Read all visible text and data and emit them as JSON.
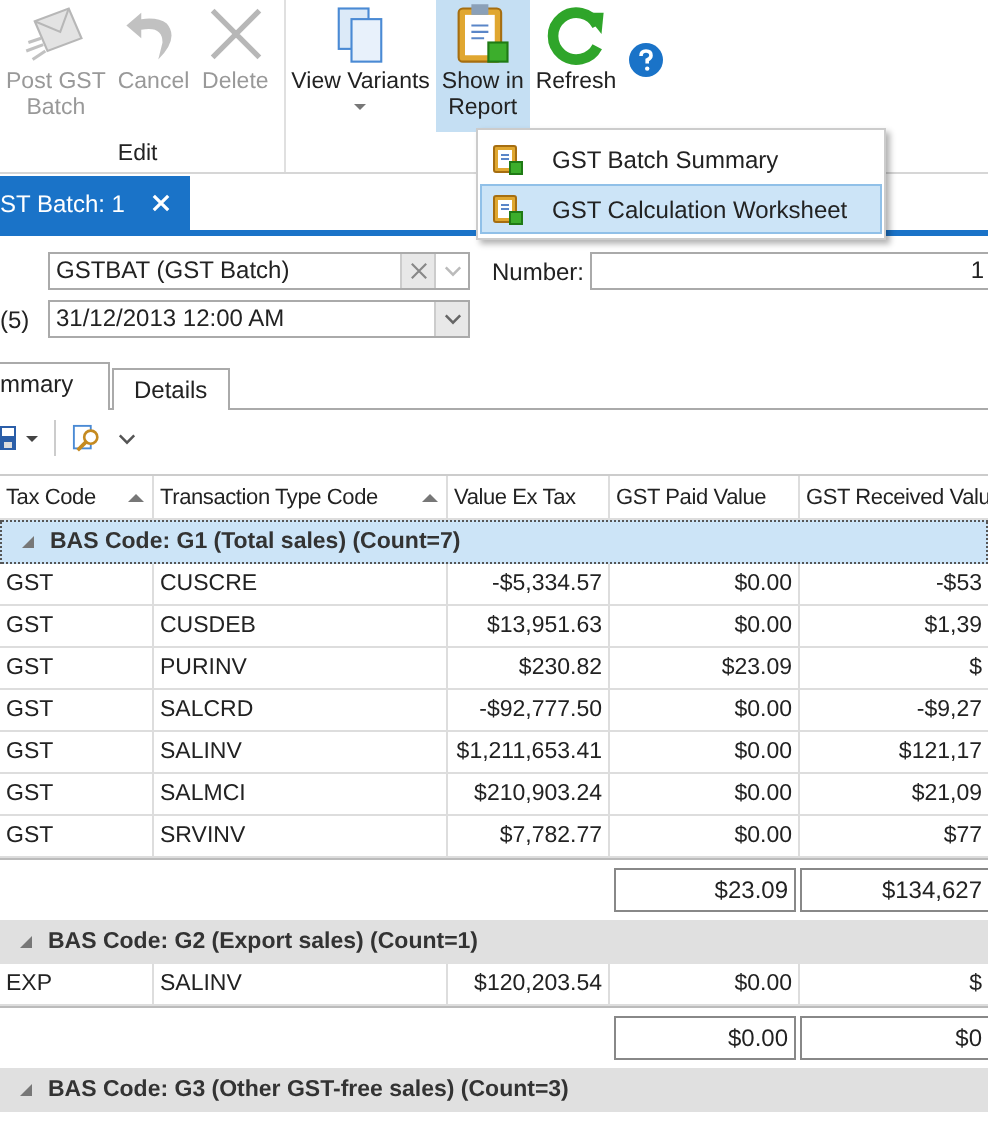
{
  "ribbon": {
    "groups": [
      {
        "label": "Edit",
        "buttons": [
          {
            "label": "Post GST\nBatch",
            "kind": "mail",
            "disabled": true,
            "dropdown": false,
            "selected": false
          },
          {
            "label": "Cancel",
            "kind": "undo",
            "disabled": true,
            "dropdown": false,
            "selected": false
          },
          {
            "label": "Delete",
            "kind": "delete",
            "disabled": true,
            "dropdown": false,
            "selected": false
          }
        ]
      },
      {
        "buttons": [
          {
            "label": "View Variants",
            "kind": "pages",
            "disabled": false,
            "dropdown": true,
            "selected": false
          },
          {
            "label": "Show in\nReport",
            "kind": "report",
            "disabled": false,
            "dropdown": true,
            "selected": true
          },
          {
            "label": "Refresh",
            "kind": "refresh",
            "disabled": false,
            "dropdown": false,
            "selected": false
          },
          {
            "kind": "help",
            "disabled": false,
            "dropdown": false,
            "selected": false
          }
        ]
      }
    ]
  },
  "menu": {
    "items": [
      {
        "label": "GST Batch Summary",
        "selected": false
      },
      {
        "label": "GST Calculation Worksheet",
        "selected": true
      }
    ]
  },
  "document_tabs": [
    {
      "label": "ST Batch: 1",
      "selected": true
    }
  ],
  "form": {
    "document_type": "GSTBAT (GST Batch)",
    "number_label": "Number:",
    "number": "1",
    "date_label": "(5)",
    "date": "31/12/2013 12:00 AM"
  },
  "subtabs": [
    {
      "label": "mmary",
      "selected": true
    },
    {
      "label": "Details",
      "selected": false
    }
  ],
  "grid": {
    "columns": [
      {
        "label": "Tax Code",
        "sorted": true
      },
      {
        "label": "Transaction Type Code",
        "sorted": true
      },
      {
        "label": "Value Ex Tax",
        "sorted": false
      },
      {
        "label": "GST Paid Value",
        "sorted": false
      },
      {
        "label": "GST Received Valu",
        "sorted": false
      }
    ],
    "groups": [
      {
        "title": "BAS Code: G1 (Total sales) (Count=7)",
        "selected": true,
        "rows": [
          [
            "GST",
            "CUSCRE",
            "-$5,334.57",
            "$0.00",
            "-$53"
          ],
          [
            "GST",
            "CUSDEB",
            "$13,951.63",
            "$0.00",
            "$1,39"
          ],
          [
            "GST",
            "PURINV",
            "$230.82",
            "$23.09",
            "$"
          ],
          [
            "GST",
            "SALCRD",
            "-$92,777.50",
            "$0.00",
            "-$9,27"
          ],
          [
            "GST",
            "SALINV",
            "$1,211,653.41",
            "$0.00",
            "$121,17"
          ],
          [
            "GST",
            "SALMCI",
            "$210,903.24",
            "$0.00",
            "$21,09"
          ],
          [
            "GST",
            "SRVINV",
            "$7,782.77",
            "$0.00",
            "$77"
          ]
        ],
        "totals": [
          "$23.09",
          "$134,627"
        ]
      },
      {
        "title": "BAS Code: G2 (Export sales) (Count=1)",
        "selected": false,
        "rows": [
          [
            "EXP",
            "SALINV",
            "$120,203.54",
            "$0.00",
            "$"
          ]
        ],
        "totals": [
          "$0.00",
          "$0"
        ]
      },
      {
        "title": "BAS Code: G3 (Other GST-free sales) (Count=3)",
        "selected": false
      }
    ]
  }
}
